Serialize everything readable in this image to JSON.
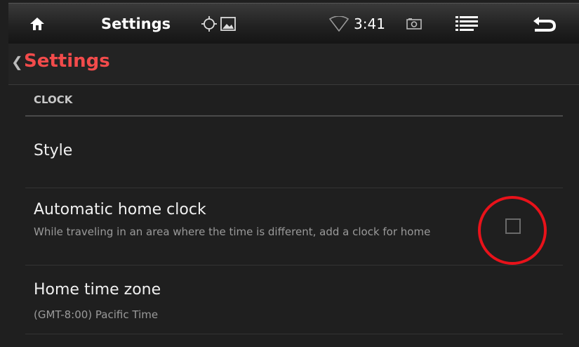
{
  "status_bar": {
    "title": "Settings",
    "time": "3:41",
    "icons": {
      "home": "home-icon",
      "location": "location-crosshair-icon",
      "gallery": "gallery-image-icon",
      "wifi": "wifi-icon",
      "camera": "camera-icon",
      "menu": "menu-lines-icon",
      "back": "back-arrow-icon"
    },
    "accent_color": "#35b5e5"
  },
  "action_bar": {
    "up_caret": "❮",
    "title": "Settings",
    "title_color": "#f24b4b"
  },
  "section": {
    "header": "CLOCK"
  },
  "items": [
    {
      "title": "Style"
    },
    {
      "title": "Automatic home clock",
      "summary": "While traveling in an area where the time is different, add a clock for home",
      "checked": false
    },
    {
      "title": "Home time zone",
      "summary": "(GMT-8:00) Pacific Time"
    }
  ],
  "annotation": {
    "color": "#e8121a"
  }
}
